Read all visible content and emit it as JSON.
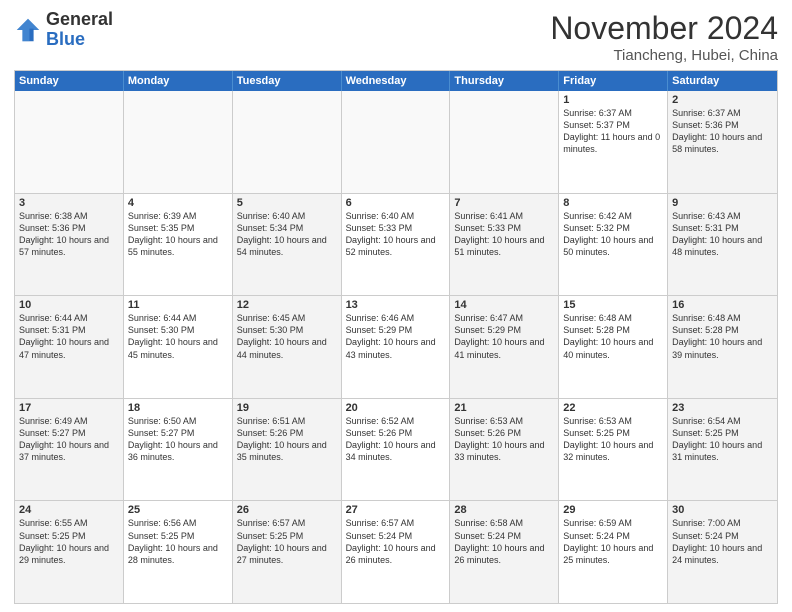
{
  "header": {
    "logo_general": "General",
    "logo_blue": "Blue",
    "month_title": "November 2024",
    "location": "Tiancheng, Hubei, China"
  },
  "calendar": {
    "days_of_week": [
      "Sunday",
      "Monday",
      "Tuesday",
      "Wednesday",
      "Thursday",
      "Friday",
      "Saturday"
    ],
    "weeks": [
      [
        {
          "day": "",
          "empty": true
        },
        {
          "day": "",
          "empty": true
        },
        {
          "day": "",
          "empty": true
        },
        {
          "day": "",
          "empty": true
        },
        {
          "day": "",
          "empty": true
        },
        {
          "day": "1",
          "sunrise": "6:37 AM",
          "sunset": "5:37 PM",
          "daylight": "11 hours and 0 minutes."
        },
        {
          "day": "2",
          "sunrise": "6:37 AM",
          "sunset": "5:36 PM",
          "daylight": "10 hours and 58 minutes."
        }
      ],
      [
        {
          "day": "3",
          "sunrise": "6:38 AM",
          "sunset": "5:36 PM",
          "daylight": "10 hours and 57 minutes."
        },
        {
          "day": "4",
          "sunrise": "6:39 AM",
          "sunset": "5:35 PM",
          "daylight": "10 hours and 55 minutes."
        },
        {
          "day": "5",
          "sunrise": "6:40 AM",
          "sunset": "5:34 PM",
          "daylight": "10 hours and 54 minutes."
        },
        {
          "day": "6",
          "sunrise": "6:40 AM",
          "sunset": "5:33 PM",
          "daylight": "10 hours and 52 minutes."
        },
        {
          "day": "7",
          "sunrise": "6:41 AM",
          "sunset": "5:33 PM",
          "daylight": "10 hours and 51 minutes."
        },
        {
          "day": "8",
          "sunrise": "6:42 AM",
          "sunset": "5:32 PM",
          "daylight": "10 hours and 50 minutes."
        },
        {
          "day": "9",
          "sunrise": "6:43 AM",
          "sunset": "5:31 PM",
          "daylight": "10 hours and 48 minutes."
        }
      ],
      [
        {
          "day": "10",
          "sunrise": "6:44 AM",
          "sunset": "5:31 PM",
          "daylight": "10 hours and 47 minutes."
        },
        {
          "day": "11",
          "sunrise": "6:44 AM",
          "sunset": "5:30 PM",
          "daylight": "10 hours and 45 minutes."
        },
        {
          "day": "12",
          "sunrise": "6:45 AM",
          "sunset": "5:30 PM",
          "daylight": "10 hours and 44 minutes."
        },
        {
          "day": "13",
          "sunrise": "6:46 AM",
          "sunset": "5:29 PM",
          "daylight": "10 hours and 43 minutes."
        },
        {
          "day": "14",
          "sunrise": "6:47 AM",
          "sunset": "5:29 PM",
          "daylight": "10 hours and 41 minutes."
        },
        {
          "day": "15",
          "sunrise": "6:48 AM",
          "sunset": "5:28 PM",
          "daylight": "10 hours and 40 minutes."
        },
        {
          "day": "16",
          "sunrise": "6:48 AM",
          "sunset": "5:28 PM",
          "daylight": "10 hours and 39 minutes."
        }
      ],
      [
        {
          "day": "17",
          "sunrise": "6:49 AM",
          "sunset": "5:27 PM",
          "daylight": "10 hours and 37 minutes."
        },
        {
          "day": "18",
          "sunrise": "6:50 AM",
          "sunset": "5:27 PM",
          "daylight": "10 hours and 36 minutes."
        },
        {
          "day": "19",
          "sunrise": "6:51 AM",
          "sunset": "5:26 PM",
          "daylight": "10 hours and 35 minutes."
        },
        {
          "day": "20",
          "sunrise": "6:52 AM",
          "sunset": "5:26 PM",
          "daylight": "10 hours and 34 minutes."
        },
        {
          "day": "21",
          "sunrise": "6:53 AM",
          "sunset": "5:26 PM",
          "daylight": "10 hours and 33 minutes."
        },
        {
          "day": "22",
          "sunrise": "6:53 AM",
          "sunset": "5:25 PM",
          "daylight": "10 hours and 32 minutes."
        },
        {
          "day": "23",
          "sunrise": "6:54 AM",
          "sunset": "5:25 PM",
          "daylight": "10 hours and 31 minutes."
        }
      ],
      [
        {
          "day": "24",
          "sunrise": "6:55 AM",
          "sunset": "5:25 PM",
          "daylight": "10 hours and 29 minutes."
        },
        {
          "day": "25",
          "sunrise": "6:56 AM",
          "sunset": "5:25 PM",
          "daylight": "10 hours and 28 minutes."
        },
        {
          "day": "26",
          "sunrise": "6:57 AM",
          "sunset": "5:25 PM",
          "daylight": "10 hours and 27 minutes."
        },
        {
          "day": "27",
          "sunrise": "6:57 AM",
          "sunset": "5:24 PM",
          "daylight": "10 hours and 26 minutes."
        },
        {
          "day": "28",
          "sunrise": "6:58 AM",
          "sunset": "5:24 PM",
          "daylight": "10 hours and 26 minutes."
        },
        {
          "day": "29",
          "sunrise": "6:59 AM",
          "sunset": "5:24 PM",
          "daylight": "10 hours and 25 minutes."
        },
        {
          "day": "30",
          "sunrise": "7:00 AM",
          "sunset": "5:24 PM",
          "daylight": "10 hours and 24 minutes."
        }
      ]
    ]
  }
}
